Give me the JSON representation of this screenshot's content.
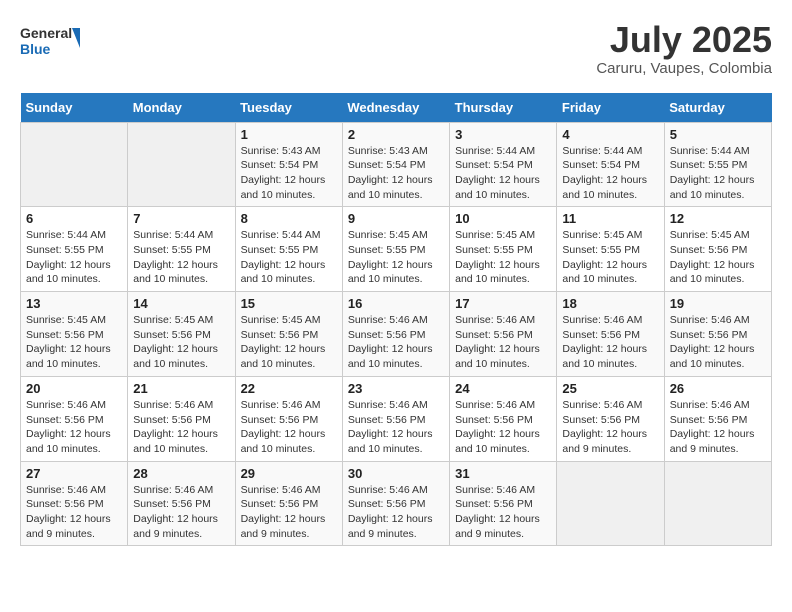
{
  "header": {
    "logo_general": "General",
    "logo_blue": "Blue",
    "title": "July 2025",
    "subtitle": "Caruru, Vaupes, Colombia"
  },
  "calendar": {
    "days_of_week": [
      "Sunday",
      "Monday",
      "Tuesday",
      "Wednesday",
      "Thursday",
      "Friday",
      "Saturday"
    ],
    "weeks": [
      [
        {
          "day": "",
          "details": ""
        },
        {
          "day": "",
          "details": ""
        },
        {
          "day": "1",
          "details": "Sunrise: 5:43 AM\nSunset: 5:54 PM\nDaylight: 12 hours and 10 minutes."
        },
        {
          "day": "2",
          "details": "Sunrise: 5:43 AM\nSunset: 5:54 PM\nDaylight: 12 hours and 10 minutes."
        },
        {
          "day": "3",
          "details": "Sunrise: 5:44 AM\nSunset: 5:54 PM\nDaylight: 12 hours and 10 minutes."
        },
        {
          "day": "4",
          "details": "Sunrise: 5:44 AM\nSunset: 5:54 PM\nDaylight: 12 hours and 10 minutes."
        },
        {
          "day": "5",
          "details": "Sunrise: 5:44 AM\nSunset: 5:55 PM\nDaylight: 12 hours and 10 minutes."
        }
      ],
      [
        {
          "day": "6",
          "details": "Sunrise: 5:44 AM\nSunset: 5:55 PM\nDaylight: 12 hours and 10 minutes."
        },
        {
          "day": "7",
          "details": "Sunrise: 5:44 AM\nSunset: 5:55 PM\nDaylight: 12 hours and 10 minutes."
        },
        {
          "day": "8",
          "details": "Sunrise: 5:44 AM\nSunset: 5:55 PM\nDaylight: 12 hours and 10 minutes."
        },
        {
          "day": "9",
          "details": "Sunrise: 5:45 AM\nSunset: 5:55 PM\nDaylight: 12 hours and 10 minutes."
        },
        {
          "day": "10",
          "details": "Sunrise: 5:45 AM\nSunset: 5:55 PM\nDaylight: 12 hours and 10 minutes."
        },
        {
          "day": "11",
          "details": "Sunrise: 5:45 AM\nSunset: 5:55 PM\nDaylight: 12 hours and 10 minutes."
        },
        {
          "day": "12",
          "details": "Sunrise: 5:45 AM\nSunset: 5:56 PM\nDaylight: 12 hours and 10 minutes."
        }
      ],
      [
        {
          "day": "13",
          "details": "Sunrise: 5:45 AM\nSunset: 5:56 PM\nDaylight: 12 hours and 10 minutes."
        },
        {
          "day": "14",
          "details": "Sunrise: 5:45 AM\nSunset: 5:56 PM\nDaylight: 12 hours and 10 minutes."
        },
        {
          "day": "15",
          "details": "Sunrise: 5:45 AM\nSunset: 5:56 PM\nDaylight: 12 hours and 10 minutes."
        },
        {
          "day": "16",
          "details": "Sunrise: 5:46 AM\nSunset: 5:56 PM\nDaylight: 12 hours and 10 minutes."
        },
        {
          "day": "17",
          "details": "Sunrise: 5:46 AM\nSunset: 5:56 PM\nDaylight: 12 hours and 10 minutes."
        },
        {
          "day": "18",
          "details": "Sunrise: 5:46 AM\nSunset: 5:56 PM\nDaylight: 12 hours and 10 minutes."
        },
        {
          "day": "19",
          "details": "Sunrise: 5:46 AM\nSunset: 5:56 PM\nDaylight: 12 hours and 10 minutes."
        }
      ],
      [
        {
          "day": "20",
          "details": "Sunrise: 5:46 AM\nSunset: 5:56 PM\nDaylight: 12 hours and 10 minutes."
        },
        {
          "day": "21",
          "details": "Sunrise: 5:46 AM\nSunset: 5:56 PM\nDaylight: 12 hours and 10 minutes."
        },
        {
          "day": "22",
          "details": "Sunrise: 5:46 AM\nSunset: 5:56 PM\nDaylight: 12 hours and 10 minutes."
        },
        {
          "day": "23",
          "details": "Sunrise: 5:46 AM\nSunset: 5:56 PM\nDaylight: 12 hours and 10 minutes."
        },
        {
          "day": "24",
          "details": "Sunrise: 5:46 AM\nSunset: 5:56 PM\nDaylight: 12 hours and 10 minutes."
        },
        {
          "day": "25",
          "details": "Sunrise: 5:46 AM\nSunset: 5:56 PM\nDaylight: 12 hours and 9 minutes."
        },
        {
          "day": "26",
          "details": "Sunrise: 5:46 AM\nSunset: 5:56 PM\nDaylight: 12 hours and 9 minutes."
        }
      ],
      [
        {
          "day": "27",
          "details": "Sunrise: 5:46 AM\nSunset: 5:56 PM\nDaylight: 12 hours and 9 minutes."
        },
        {
          "day": "28",
          "details": "Sunrise: 5:46 AM\nSunset: 5:56 PM\nDaylight: 12 hours and 9 minutes."
        },
        {
          "day": "29",
          "details": "Sunrise: 5:46 AM\nSunset: 5:56 PM\nDaylight: 12 hours and 9 minutes."
        },
        {
          "day": "30",
          "details": "Sunrise: 5:46 AM\nSunset: 5:56 PM\nDaylight: 12 hours and 9 minutes."
        },
        {
          "day": "31",
          "details": "Sunrise: 5:46 AM\nSunset: 5:56 PM\nDaylight: 12 hours and 9 minutes."
        },
        {
          "day": "",
          "details": ""
        },
        {
          "day": "",
          "details": ""
        }
      ]
    ]
  }
}
